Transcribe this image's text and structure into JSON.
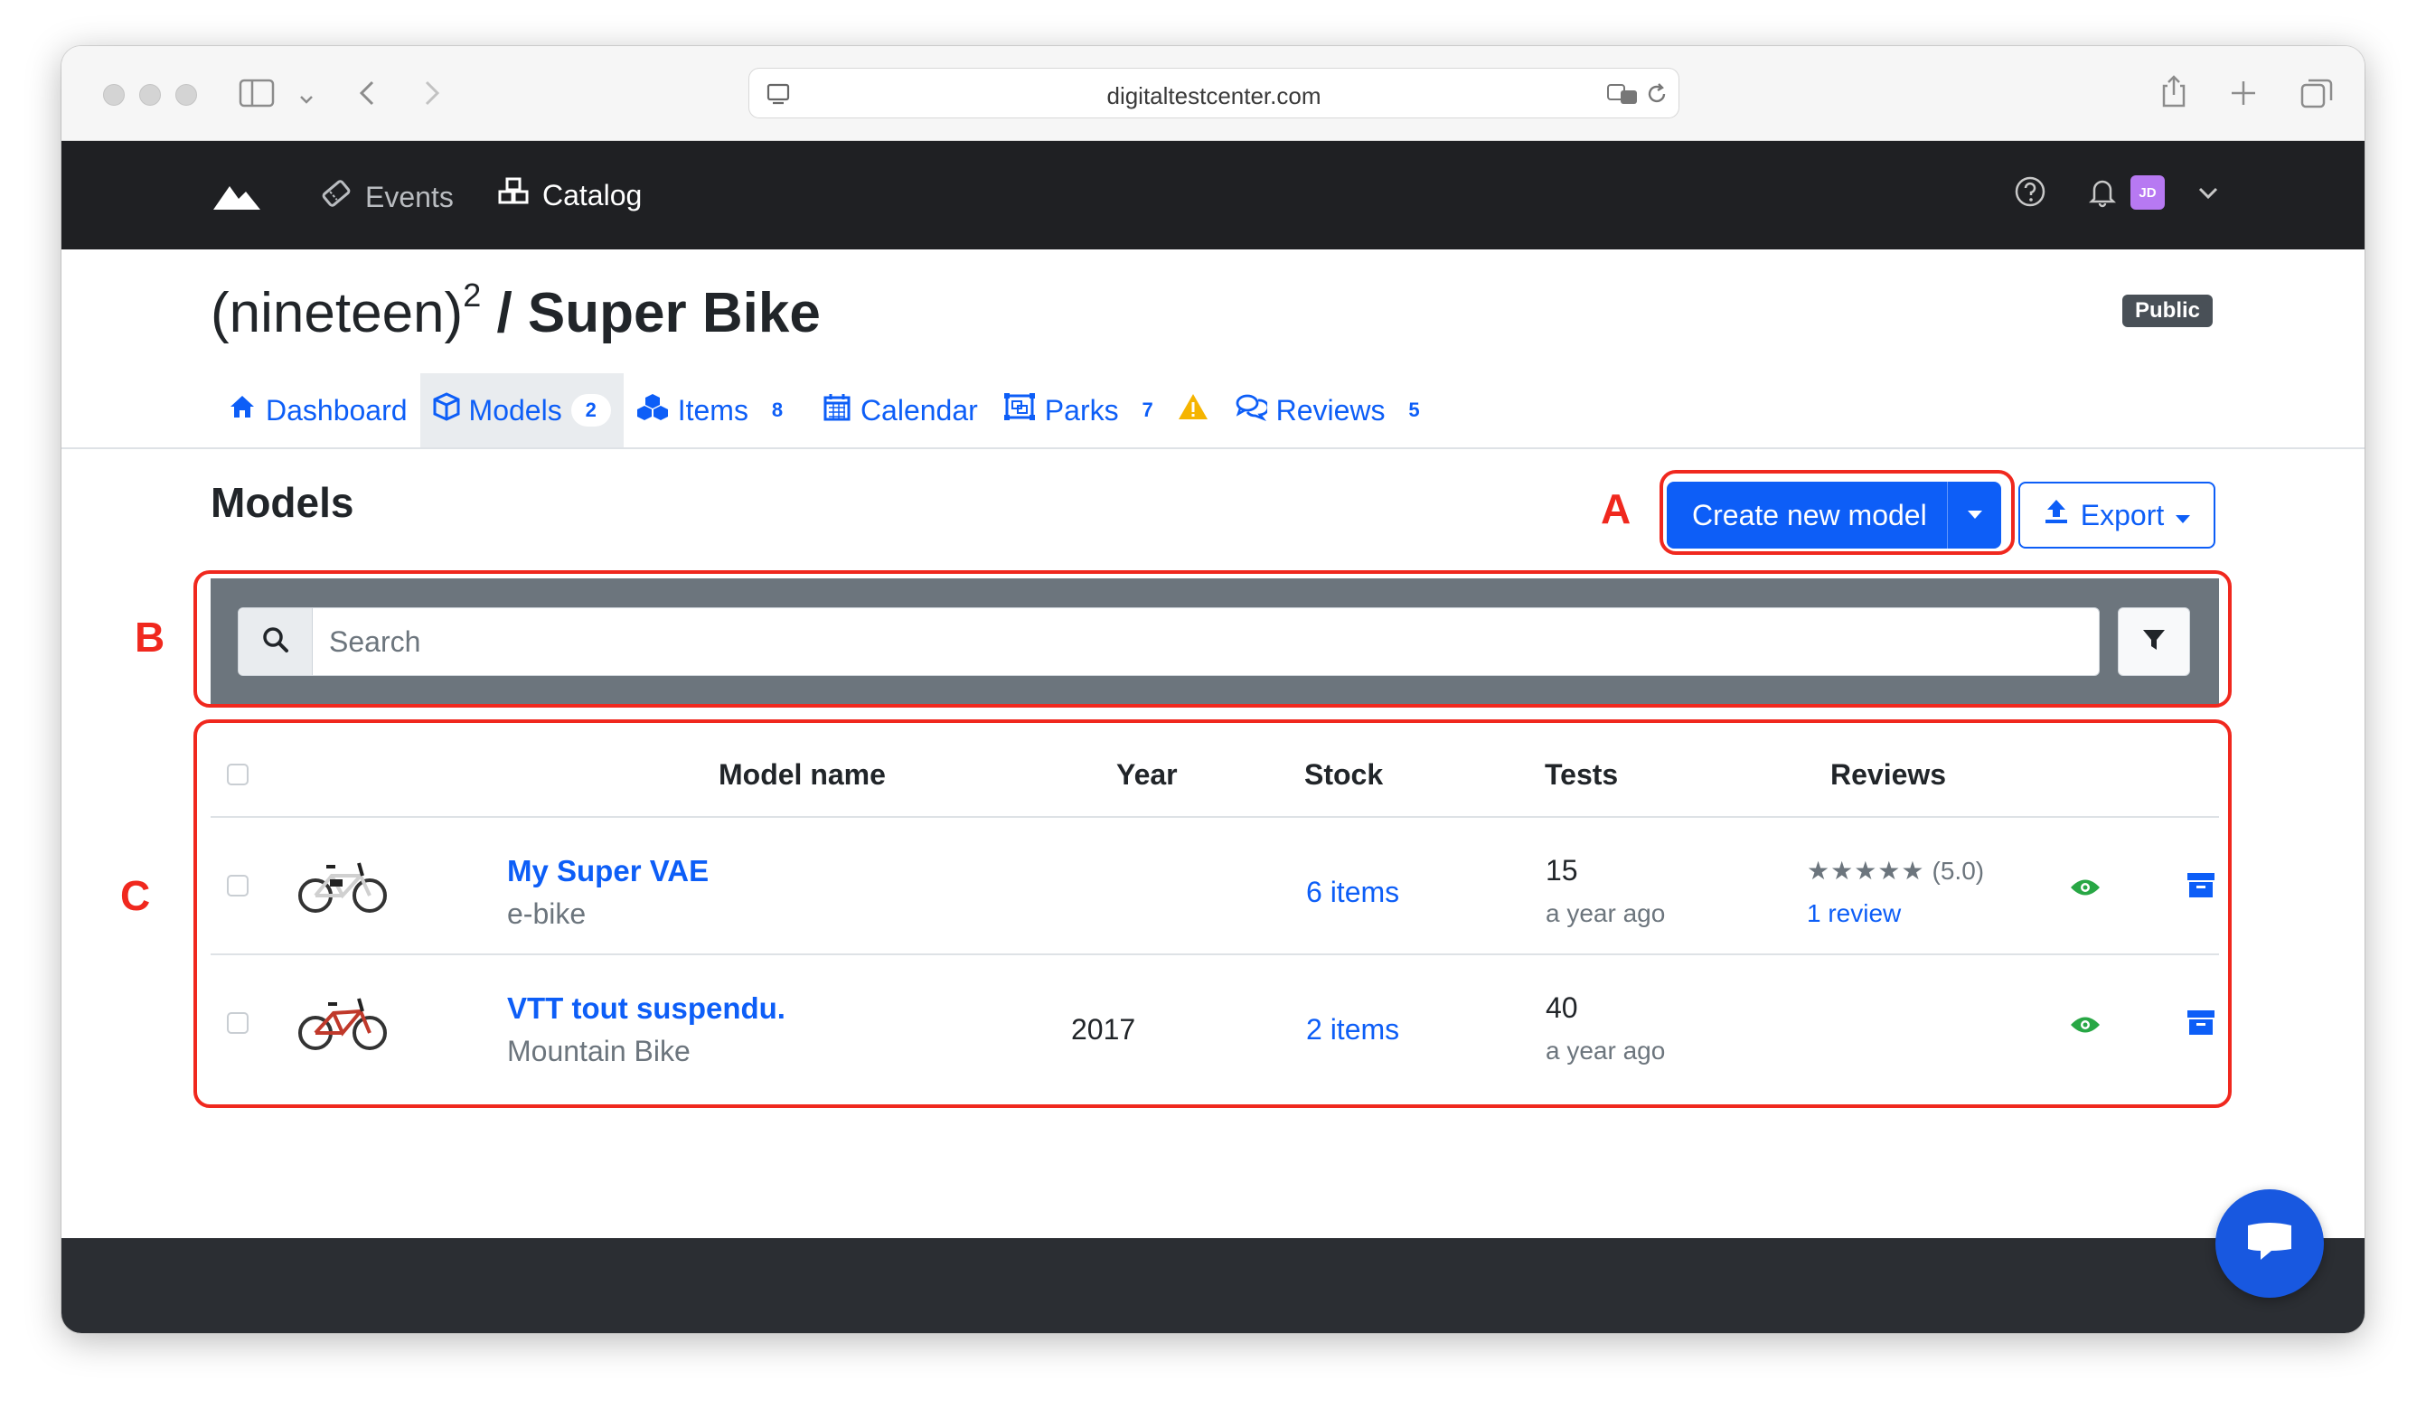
{
  "browser": {
    "url": "digitaltestcenter.com"
  },
  "nav": {
    "events": "Events",
    "catalog": "Catalog",
    "avatar_initials": "JD"
  },
  "header": {
    "title_prefix": "(nineteen)",
    "title_superscript": "2",
    "title_separator": " / ",
    "title_main": "Super Bike",
    "visibility_badge": "Public"
  },
  "tabs": [
    {
      "label": "Dashboard",
      "count": ""
    },
    {
      "label": "Models",
      "count": "2"
    },
    {
      "label": "Items",
      "count": "8"
    },
    {
      "label": "Calendar",
      "count": ""
    },
    {
      "label": "Parks",
      "count": "7"
    },
    {
      "label": "Reviews",
      "count": "5"
    }
  ],
  "section": {
    "title": "Models",
    "create_button": "Create new model",
    "export_button": "Export"
  },
  "search": {
    "placeholder": "Search"
  },
  "table": {
    "columns": [
      "Model name",
      "Year",
      "Stock",
      "Tests",
      "Reviews"
    ],
    "rows": [
      {
        "name": "My Super VAE",
        "category": "e-bike",
        "year": "",
        "stock": "6 items",
        "tests": "15",
        "tests_when": "a year ago",
        "rating_text": "(5.0)",
        "rating_stars": 5,
        "reviews_link": "1 review"
      },
      {
        "name": "VTT tout suspendu.",
        "category": "Mountain Bike",
        "year": "2017",
        "stock": "2 items",
        "tests": "40",
        "tests_when": "a year ago",
        "rating_text": "",
        "rating_stars": 0,
        "reviews_link": ""
      }
    ]
  },
  "annotations": {
    "a": "A",
    "b": "B",
    "c": "C"
  },
  "colors": {
    "primary": "#0d5ef7",
    "annotation": "#f0281e",
    "navbar": "#1f2023",
    "view_icon": "#28a745"
  }
}
